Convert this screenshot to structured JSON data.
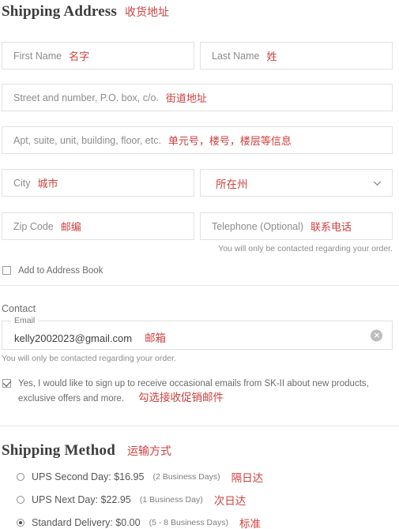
{
  "shipping_address": {
    "title": "Shipping Address",
    "title_cn": "收货地址",
    "fields": {
      "first_name": {
        "placeholder": "First Name",
        "cn": "名字"
      },
      "last_name": {
        "placeholder": "Last Name",
        "cn": "姓"
      },
      "street": {
        "placeholder": "Street and number, P.O. box, c/o.",
        "cn": "街道地址"
      },
      "apt": {
        "placeholder": "Apt, suite, unit, building, floor, etc.",
        "cn": "单元号，楼号，楼层等信息"
      },
      "city": {
        "placeholder": "City",
        "cn": "城市"
      },
      "state": {
        "placeholder": "",
        "cn": "所在州",
        "icon": "chevron-down-icon"
      },
      "zip": {
        "placeholder": "Zip Code",
        "cn": "邮编"
      },
      "telephone": {
        "placeholder": "Telephone (Optional)",
        "cn": "联系电话"
      }
    },
    "telephone_helper": "You will only be contacted regarding your order.",
    "add_to_address_book": {
      "label": "Add to Address Book",
      "checked": false
    }
  },
  "contact": {
    "label": "Contact",
    "email": {
      "legend": "Email",
      "value": "kelly2002023@gmail.com",
      "cn": "邮箱",
      "clear_icon": "clear-circle-icon"
    },
    "email_helper": "You will only be contacted regarding your order.",
    "optin": {
      "line1": "Yes, I would like to sign up to receive occasional emails from SK-II about new products,",
      "line2": "exclusive offers and more.",
      "cn": "勾选接收促销邮件",
      "checked": true
    }
  },
  "shipping_method": {
    "title": "Shipping Method",
    "title_cn": "运输方式",
    "options": [
      {
        "label": "UPS Second Day: $16.95",
        "days": "(2 Business Days)",
        "cn": "隔日达",
        "selected": false
      },
      {
        "label": "UPS Next Day: $22.95",
        "days": "(1 Business Day)",
        "cn": "次日达",
        "selected": false
      },
      {
        "label": "Standard Delivery: $0.00",
        "days": "(5 - 8 Business Days)",
        "cn": "标准",
        "selected": true
      }
    ]
  },
  "colors": {
    "annotation_red": "#cf4040",
    "border": "#e2e2e2",
    "text": "#555555"
  }
}
